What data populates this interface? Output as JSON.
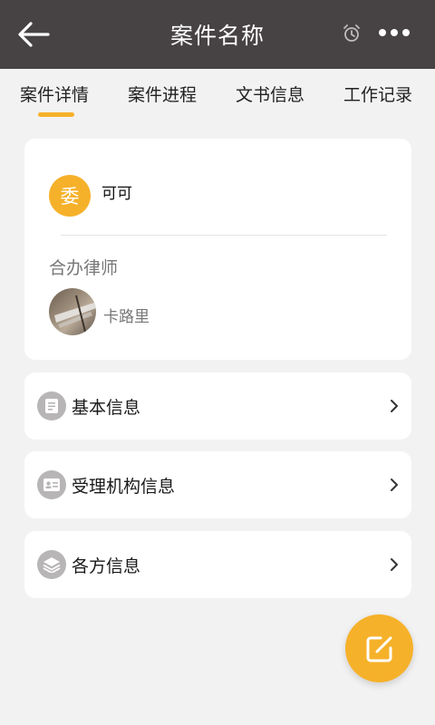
{
  "header": {
    "title": "案件名称",
    "back_icon": "arrow-left-icon",
    "alarm_icon": "alarm-clock-icon",
    "more_icon": "more-dots-icon"
  },
  "tabs": [
    {
      "label": "案件详情",
      "active": true
    },
    {
      "label": "案件进程",
      "active": false
    },
    {
      "label": "文书信息",
      "active": false
    },
    {
      "label": "工作记录",
      "active": false
    }
  ],
  "lawyer_card": {
    "badge_char": "委",
    "client_name": "可可",
    "co_counsel_label": "合办律师",
    "co_counsel_name": "卡路里"
  },
  "sections": [
    {
      "label": "基本信息",
      "icon": "document-list-icon"
    },
    {
      "label": "受理机构信息",
      "icon": "id-card-icon"
    },
    {
      "label": "各方信息",
      "icon": "layers-icon"
    }
  ],
  "fab": {
    "icon": "edit-icon"
  },
  "colors": {
    "header_bg": "#474244",
    "accent": "#f6b12a",
    "page_bg": "#f2f2f2",
    "icon_circle": "#b8b5b6"
  }
}
